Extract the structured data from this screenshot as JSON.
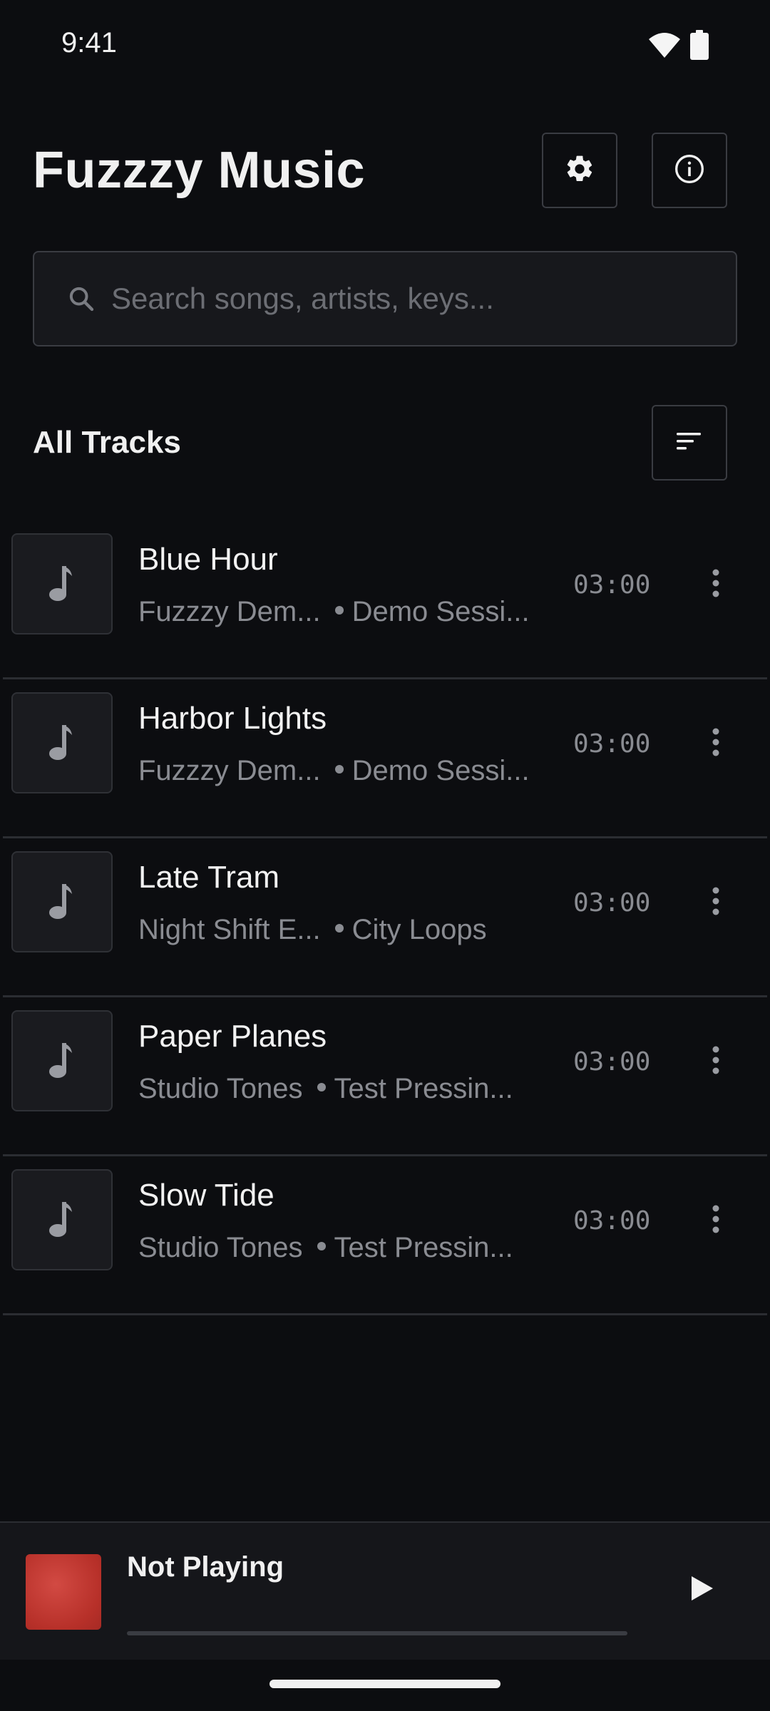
{
  "status_bar": {
    "time": "9:41"
  },
  "header": {
    "title": "Fuzzzy Music"
  },
  "search": {
    "placeholder": "Search songs, artists, keys..."
  },
  "section": {
    "title": "All Tracks"
  },
  "tracks": [
    {
      "title": "Blue Hour",
      "artist": "Fuzzzy Dem...",
      "album": "Demo Sessi...",
      "duration": "03:00"
    },
    {
      "title": "Harbor Lights",
      "artist": "Fuzzzy Dem...",
      "album": "Demo Sessi...",
      "duration": "03:00"
    },
    {
      "title": "Late Tram",
      "artist": "Night Shift E...",
      "album": "City Loops",
      "duration": "03:00"
    },
    {
      "title": "Paper Planes",
      "artist": "Studio Tones",
      "album": "Test Pressin...",
      "duration": "03:00"
    },
    {
      "title": "Slow Tide",
      "artist": "Studio Tones",
      "album": "Test Pressin...",
      "duration": "03:00"
    }
  ],
  "player": {
    "title": "Not Playing",
    "progress": 0,
    "art_color": "#c0392b"
  },
  "icons": {
    "settings": "gear-icon",
    "info": "info-icon",
    "sort": "sort-icon",
    "search": "search-icon",
    "track_thumb": "music-note-icon",
    "more": "more-vertical-icon",
    "play": "play-icon"
  },
  "colors": {
    "background": "#0c0d10",
    "surface": "#17181c",
    "border": "#3a3c42",
    "muted_text": "#8a8c92"
  }
}
